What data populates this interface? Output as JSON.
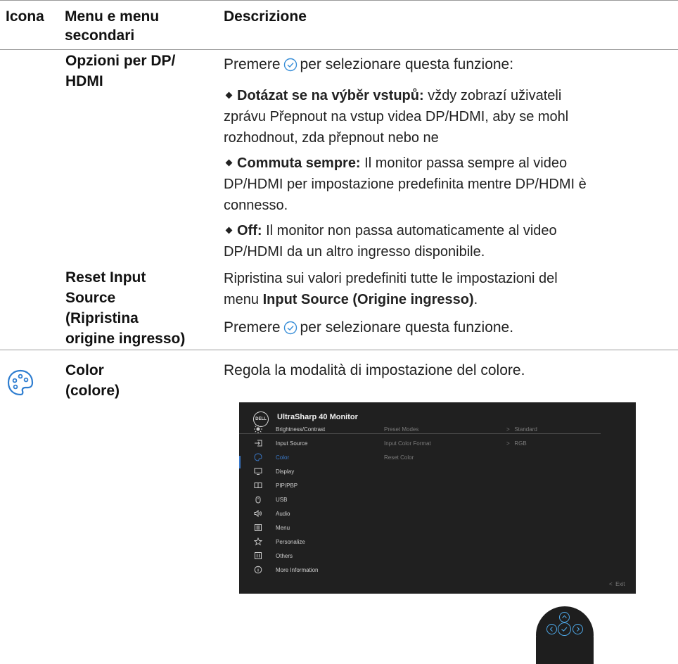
{
  "headers": {
    "icon": "Icona",
    "menu_1": "Menu e menu",
    "menu_2": "secondari",
    "desc": "Descrizione"
  },
  "dp_hdmi": {
    "name_1": "Opzioni per DP/",
    "name_2": "HDMI",
    "intro_pre": "Premere",
    "intro_post": "per selezionare questa funzione:",
    "opt1_bold": "Dotázat se na výběr vstupů:",
    "opt1_l1": "vždy zobrazí uživateli",
    "opt1_l2": "zprávu Přepnout na vstup videa DP/HDMI, aby se mohl",
    "opt1_l3": "rozhodnout, zda přepnout nebo ne",
    "opt2_bold": "Commuta sempre:",
    "opt2_l1": "Il monitor passa sempre al video",
    "opt2_l2": "DP/HDMI per impostazione predefinita mentre DP/HDMI è",
    "opt2_l3": "connesso.",
    "opt3_bold": "Off:",
    "opt3_l1": "Il monitor non passa automaticamente al video",
    "opt3_l2": "DP/HDMI da un altro ingresso disponibile."
  },
  "reset": {
    "name_1": "Reset Input",
    "name_2": "Source",
    "name_3": "(Ripristina",
    "name_4": "origine ingresso)",
    "desc_l1": "Ripristina sui valori predefiniti tutte le impostazioni del",
    "desc_l2_pre": "menu",
    "desc_l2_bold": "Input Source (Origine ingresso)",
    "desc_l2_post": ".",
    "press_pre": "Premere",
    "press_post": "per selezionare questa funzione."
  },
  "color": {
    "icon": "palette-icon",
    "name_1": "Color",
    "name_2": "(colore)",
    "desc": "Regola la modalità di impostazione del colore."
  },
  "osd": {
    "logo": "DELL",
    "title": "UltraSharp 40 Monitor",
    "menu": [
      {
        "label": "Brightness/Contrast",
        "icon": "brightness-icon"
      },
      {
        "label": "Input Source",
        "icon": "input-source-icon"
      },
      {
        "label": "Color",
        "icon": "color-palette-icon"
      },
      {
        "label": "Display",
        "icon": "display-icon"
      },
      {
        "label": "PIP/PBP",
        "icon": "pip-pbp-icon"
      },
      {
        "label": "USB",
        "icon": "usb-icon"
      },
      {
        "label": "Audio",
        "icon": "audio-icon"
      },
      {
        "label": "Menu",
        "icon": "menu-icon"
      },
      {
        "label": "Personalize",
        "icon": "star-icon"
      },
      {
        "label": "Others",
        "icon": "others-icon"
      },
      {
        "label": "More Information",
        "icon": "info-icon"
      }
    ],
    "selected": "Color",
    "sub": [
      {
        "label": "Preset Modes",
        "value": "Standard"
      },
      {
        "label": "Input Color Format",
        "value": "RGB"
      },
      {
        "label": "Reset Color",
        "value": ""
      }
    ],
    "exit": "Exit",
    "accent": "#3a78c8"
  },
  "joystick": {
    "icons": [
      "joystick-up-icon",
      "joystick-left-icon",
      "joystick-center-check-icon",
      "joystick-right-icon",
      "joystick-down-icon"
    ],
    "accent": "#4ea8e8"
  }
}
